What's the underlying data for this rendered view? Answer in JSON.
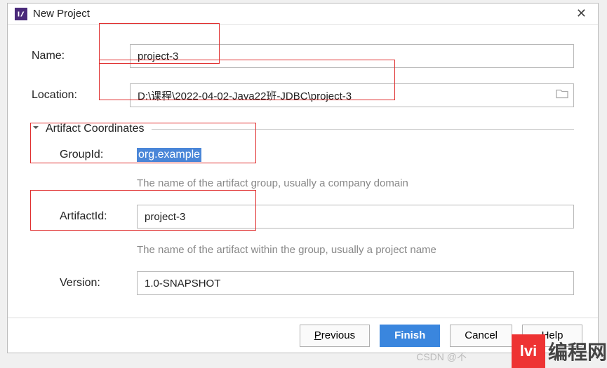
{
  "window": {
    "title": "New Project"
  },
  "fields": {
    "name_label": "Name:",
    "name_value": "project-3",
    "location_label": "Location:",
    "location_value": "D:\\课程\\2022-04-02-Java22班-JDBC\\project-3"
  },
  "section": {
    "title": "Artifact Coordinates",
    "groupid_label": "GroupId:",
    "groupid_value": "org.example",
    "groupid_hint": "The name of the artifact group, usually a company domain",
    "artifactid_label": "ArtifactId:",
    "artifactid_value": "project-3",
    "artifactid_hint": "The name of the artifact within the group, usually a project name",
    "version_label": "Version:",
    "version_value": "1.0-SNAPSHOT"
  },
  "buttons": {
    "previous": "Previous",
    "previous_key": "P",
    "previous_rest": "revious",
    "finish": "Finish",
    "cancel": "Cancel",
    "help": "Help"
  },
  "watermark": {
    "logo": "lvi",
    "text": "编程网",
    "csdn": "CSDN @不"
  }
}
